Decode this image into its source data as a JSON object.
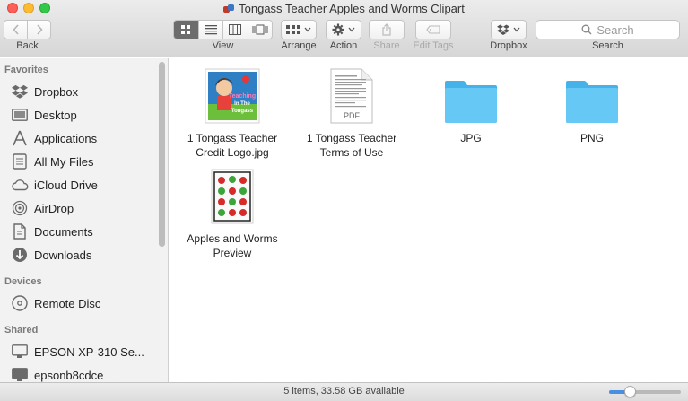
{
  "window": {
    "title": "Tongass Teacher Apples and Worms Clipart"
  },
  "toolbar": {
    "back_label": "Back",
    "view_label": "View",
    "arrange_label": "Arrange",
    "action_label": "Action",
    "share_label": "Share",
    "edit_tags_label": "Edit Tags",
    "dropbox_label": "Dropbox",
    "search_label": "Search",
    "search_placeholder": "Search"
  },
  "sidebar": {
    "favorites_header": "Favorites",
    "favorites": [
      {
        "label": "Dropbox",
        "icon": "dropbox-icon"
      },
      {
        "label": "Desktop",
        "icon": "desktop-icon"
      },
      {
        "label": "Applications",
        "icon": "applications-icon"
      },
      {
        "label": "All My Files",
        "icon": "all-files-icon"
      },
      {
        "label": "iCloud Drive",
        "icon": "cloud-icon"
      },
      {
        "label": "AirDrop",
        "icon": "airdrop-icon"
      },
      {
        "label": "Documents",
        "icon": "documents-icon"
      },
      {
        "label": "Downloads",
        "icon": "downloads-icon"
      }
    ],
    "devices_header": "Devices",
    "devices": [
      {
        "label": "Remote Disc",
        "icon": "disc-icon"
      }
    ],
    "shared_header": "Shared",
    "shared": [
      {
        "label": "EPSON XP-310 Se...",
        "icon": "display-icon"
      },
      {
        "label": "epsonb8cdce",
        "icon": "display-icon"
      }
    ]
  },
  "files": [
    {
      "name_line1": "1 Tongass Teacher",
      "name_line2": "Credit Logo.jpg",
      "kind": "image"
    },
    {
      "name_line1": "1 Tongass Teacher",
      "name_line2": "Terms of Use",
      "kind": "pdf",
      "badge": "PDF"
    },
    {
      "name_line1": "JPG",
      "name_line2": "",
      "kind": "folder"
    },
    {
      "name_line1": "PNG",
      "name_line2": "",
      "kind": "folder"
    },
    {
      "name_line1": "Apples and Worms",
      "name_line2": "Preview",
      "kind": "image"
    }
  ],
  "logo_text": "Teaching In The Tongass",
  "status": {
    "text": "5 items, 33.58 GB available",
    "icon_size_level": 0.25
  },
  "colors": {
    "folder": "#5ec4f3",
    "accent": "#4a90e2"
  }
}
